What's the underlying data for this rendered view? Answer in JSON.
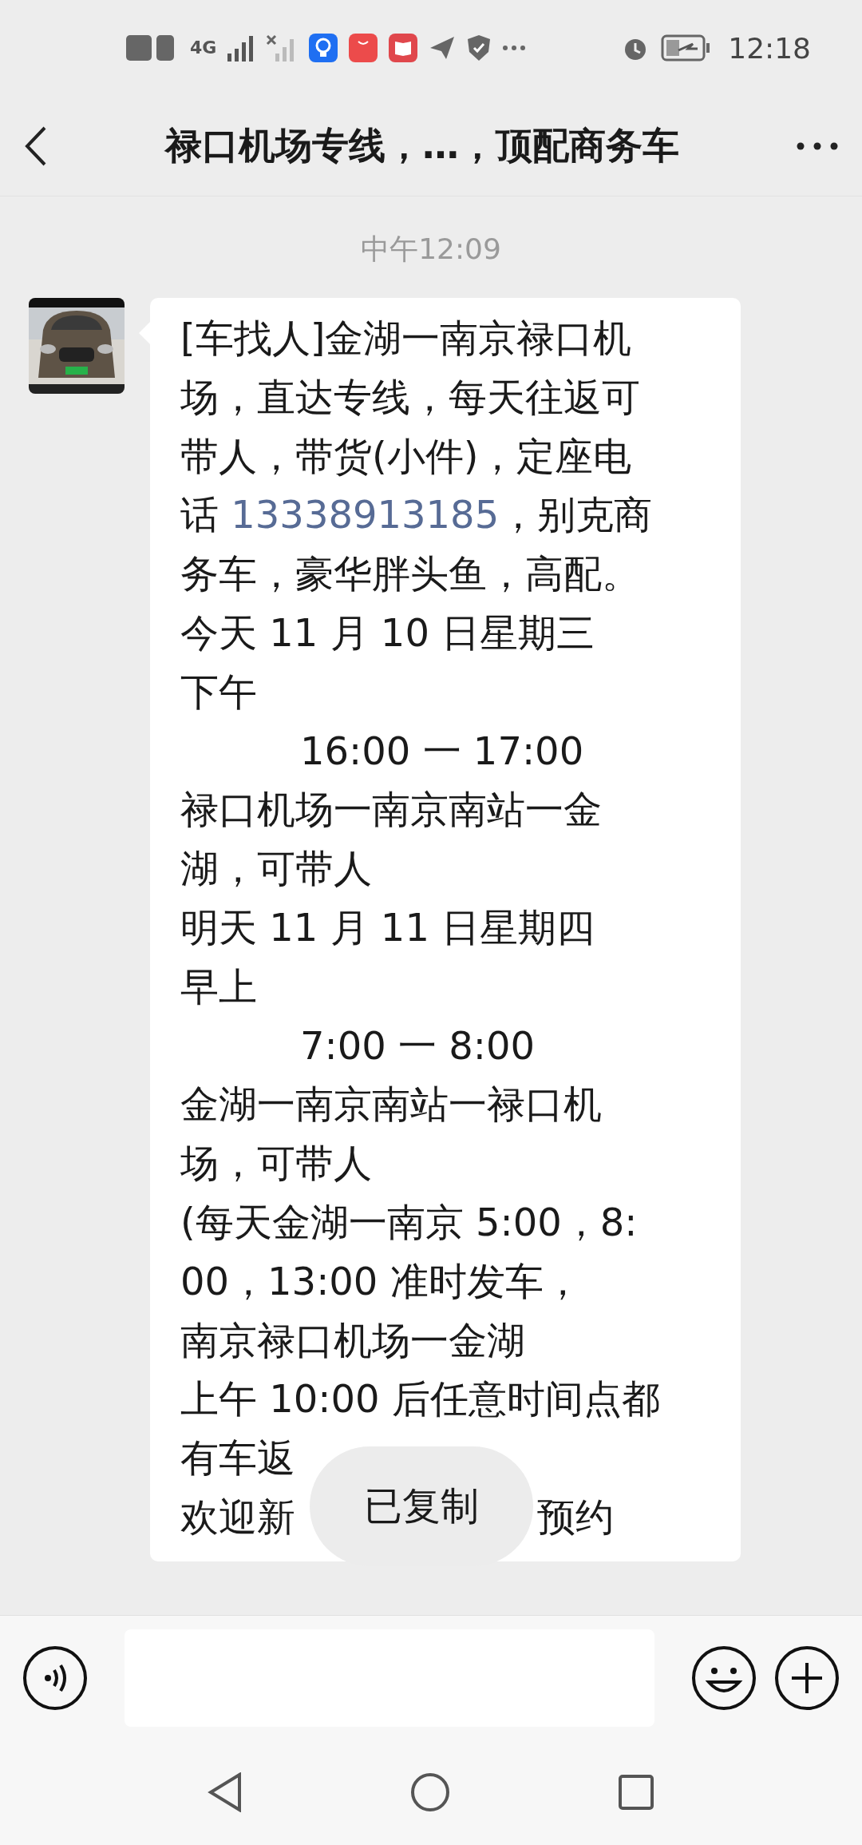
{
  "status_bar": {
    "time": "12:18",
    "network": "4G"
  },
  "header": {
    "title": "禄口机场专线，…，顶配商务车"
  },
  "timestamp": "中午12:09",
  "message": {
    "lines": [
      {
        "kind": "text",
        "text": "[车找人]金湖一南京禄口机"
      },
      {
        "kind": "text",
        "text": "场，直达专线，每天往返可"
      },
      {
        "kind": "text",
        "text": "带人，带货(小件)，定座电"
      },
      {
        "kind": "phone",
        "text": "话 ",
        "link": "13338913185",
        "after": "，别克商"
      },
      {
        "kind": "text",
        "text": "务车，豪华胖头鱼，高配。"
      },
      {
        "kind": "text",
        "text": "今天 11 月 10 日星期三"
      },
      {
        "kind": "text",
        "text": "下午"
      },
      {
        "kind": "time",
        "text": "16:00 一 17:00"
      },
      {
        "kind": "text",
        "text": "禄口机场一南京南站一金"
      },
      {
        "kind": "text",
        "text": "湖，可带人"
      },
      {
        "kind": "text",
        "text": "明天 11 月 11 日星期四"
      },
      {
        "kind": "text",
        "text": "早上"
      },
      {
        "kind": "time",
        "text": "7:00 一 8:00"
      },
      {
        "kind": "text",
        "text": "金湖一南京南站一禄口机"
      },
      {
        "kind": "text",
        "text": "场，可带人"
      },
      {
        "kind": "text",
        "text": "(每天金湖一南京 5:00，8:"
      },
      {
        "kind": "text",
        "text": "00，13:00 准时发车，"
      },
      {
        "kind": "text",
        "text": "南京禄口机场一金湖"
      },
      {
        "kind": "text",
        "text": "上午 10:00 后任意时间点都"
      },
      {
        "kind": "text",
        "text": "有车返"
      },
      {
        "kind": "covered",
        "text": "欢迎新",
        "after": "预约"
      }
    ]
  },
  "toast": "已复制"
}
